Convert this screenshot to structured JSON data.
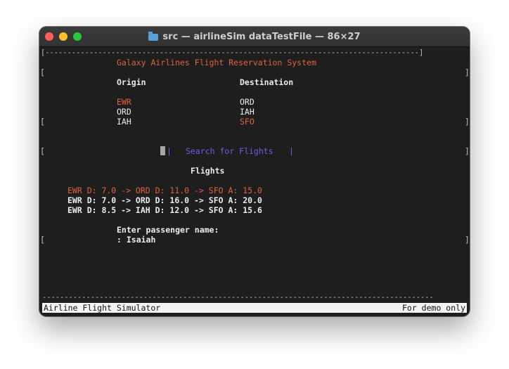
{
  "window": {
    "title": "src — airlineSim dataTestFile — 86×27",
    "folder_icon": "folder-icon"
  },
  "terminal": {
    "top_border": "[-------------------------------------------------------------------------------------]",
    "bottom_border": "-----------------------------------------------------------------------------------------",
    "system_title": "Galaxy Airlines Flight Reservation System",
    "origin_header": "Origin",
    "destination_header": "Destination",
    "origins": [
      "EWR",
      "ORD",
      "IAH"
    ],
    "destinations": [
      "ORD",
      "IAH",
      "SFO"
    ],
    "selected_origin": "EWR",
    "selected_destination": "SFO",
    "search_bar_left": "|",
    "search_label": "Search for Flights",
    "search_bar_right": "|",
    "flights_header": "Flights",
    "flights": [
      "EWR D: 7.0 -> ORD D: 11.0 -> SFO A: 15.0",
      "EWR D: 7.0 -> ORD D: 16.0 -> SFO A: 20.0",
      "EWR D: 8.5 -> IAH D: 12.0 -> SFO A: 15.6"
    ],
    "passenger_prompt": "Enter passenger name:",
    "passenger_input": ": Isaiah",
    "bracket_left": "[",
    "bracket_right": "]"
  },
  "status": {
    "left": "Airline Flight Simulator",
    "right": "For demo only"
  },
  "colors": {
    "highlight": "#e0613f",
    "button": "#6a5ee8",
    "text": "#ececec",
    "background": "#1e1e1e"
  }
}
